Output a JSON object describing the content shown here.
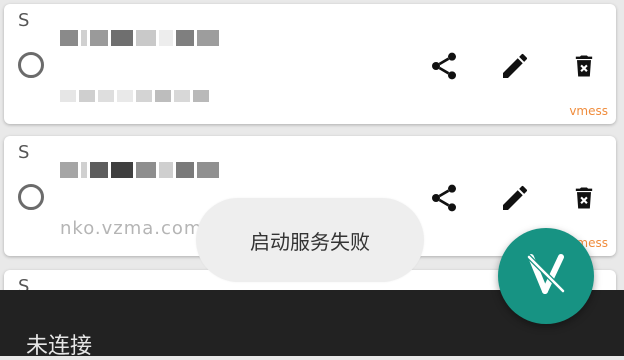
{
  "servers": [
    {
      "group_label": "S",
      "title": "",
      "subtitle": "",
      "protocol": "vmess"
    },
    {
      "group_label": "S",
      "title": "",
      "subtitle": "nko.vzma.com : 443",
      "protocol": "vmess"
    },
    {
      "group_label": "S"
    }
  ],
  "toast": {
    "message": "启动服务失败"
  },
  "bottom_bar": {
    "status": "未连接"
  },
  "colors": {
    "accent": "#179383",
    "protocol": "#f08c3c",
    "bottom_bar": "#222222"
  },
  "icons": {
    "share": "share-icon",
    "edit": "pencil-icon",
    "delete": "trash-icon",
    "fab": "v-logo-icon"
  }
}
